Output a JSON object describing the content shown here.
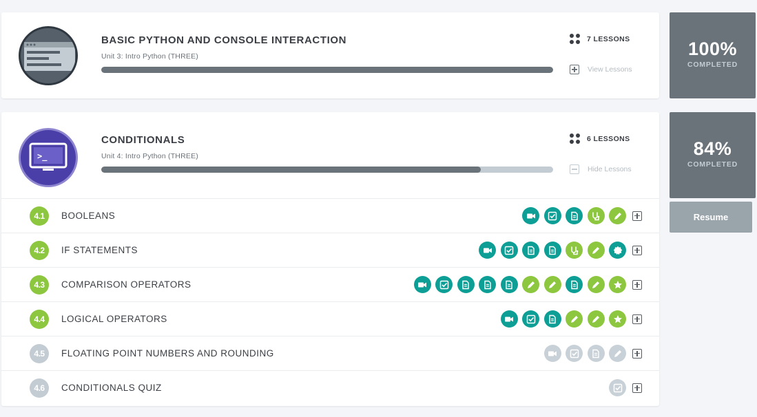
{
  "units": [
    {
      "title": "BASIC PYTHON AND CONSOLE INTERACTION",
      "subtitle": "Unit 3: Intro Python (THREE)",
      "progress": 1.0,
      "lessons_label": "7 LESSONS",
      "toggle_label": "View Lessons",
      "percent": "100%",
      "percent_label": "COMPLETED"
    },
    {
      "title": "CONDITIONALS",
      "subtitle": "Unit 4: Intro Python (THREE)",
      "progress": 0.84,
      "lessons_label": "6 LESSONS",
      "toggle_label": "Hide Lessons",
      "percent": "84%",
      "percent_label": "COMPLETED",
      "resume_label": "Resume",
      "lessons": [
        {
          "num": "4.1",
          "name": "BOOLEANS",
          "done": true,
          "items": [
            [
              "video",
              "teal"
            ],
            [
              "check",
              "teal"
            ],
            [
              "doc",
              "teal"
            ],
            [
              "lab",
              "green"
            ],
            [
              "pencil",
              "green"
            ]
          ]
        },
        {
          "num": "4.2",
          "name": "IF STATEMENTS",
          "done": true,
          "items": [
            [
              "video",
              "teal"
            ],
            [
              "check",
              "teal"
            ],
            [
              "doc",
              "teal"
            ],
            [
              "doc",
              "teal"
            ],
            [
              "lab",
              "green"
            ],
            [
              "pencil",
              "green"
            ],
            [
              "badge",
              "teal"
            ]
          ]
        },
        {
          "num": "4.3",
          "name": "COMPARISON OPERATORS",
          "done": true,
          "items": [
            [
              "video",
              "teal"
            ],
            [
              "check",
              "teal"
            ],
            [
              "doc",
              "teal"
            ],
            [
              "doc",
              "teal"
            ],
            [
              "doc",
              "teal"
            ],
            [
              "pencil",
              "green"
            ],
            [
              "pencil",
              "green"
            ],
            [
              "doc",
              "teal"
            ],
            [
              "pencil",
              "green"
            ],
            [
              "star",
              "green"
            ]
          ]
        },
        {
          "num": "4.4",
          "name": "LOGICAL OPERATORS",
          "done": true,
          "items": [
            [
              "video",
              "teal"
            ],
            [
              "check",
              "teal"
            ],
            [
              "doc",
              "teal"
            ],
            [
              "pencil",
              "green"
            ],
            [
              "pencil",
              "green"
            ],
            [
              "star",
              "green"
            ]
          ]
        },
        {
          "num": "4.5",
          "name": "FLOATING POINT NUMBERS AND ROUNDING",
          "done": false,
          "items": [
            [
              "video",
              "gray"
            ],
            [
              "check",
              "gray"
            ],
            [
              "doc",
              "gray"
            ],
            [
              "pencil",
              "gray"
            ]
          ]
        },
        {
          "num": "4.6",
          "name": "CONDITIONALS QUIZ",
          "done": false,
          "items": [
            [
              "check",
              "gray"
            ]
          ]
        }
      ]
    }
  ],
  "colors": {
    "teal": "#0d9f95",
    "green": "#8dc63f",
    "gray": "#c8d1d7",
    "slate": "#6b737a"
  }
}
